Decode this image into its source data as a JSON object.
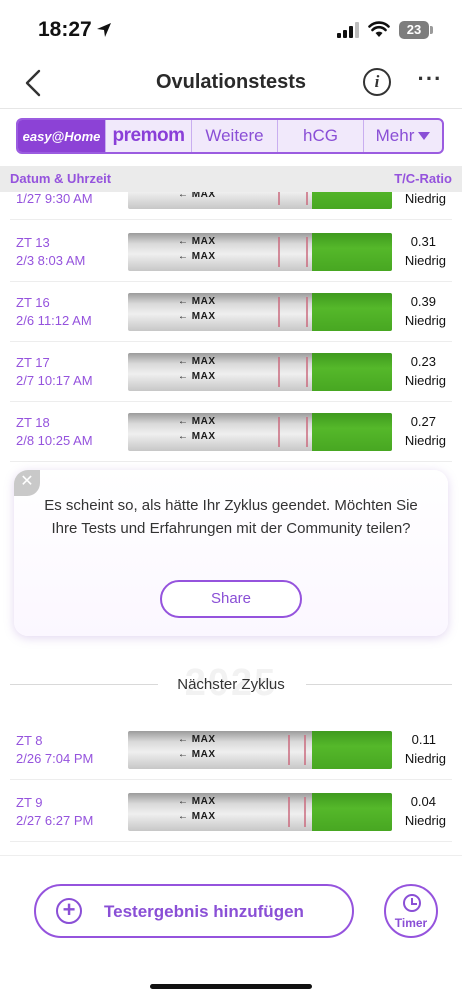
{
  "status": {
    "time": "18:27",
    "battery": "23"
  },
  "header": {
    "title": "Ovulationstests"
  },
  "tabs": [
    {
      "label": "easy@Home",
      "active": true
    },
    {
      "label": "premom"
    },
    {
      "label": "Weitere"
    },
    {
      "label": "hCG"
    },
    {
      "label": "Mehr"
    }
  ],
  "columns": {
    "date": "Datum & Uhrzeit",
    "ratio": "T/C-Ratio"
  },
  "strip_text": "MAX",
  "tests_cycle1": [
    {
      "day": "",
      "datetime": "1/27 9:30 AM",
      "ratio": "",
      "level": "Niedrig"
    },
    {
      "day": "ZT 13",
      "datetime": "2/3 8:03 AM",
      "ratio": "0.31",
      "level": "Niedrig"
    },
    {
      "day": "ZT 16",
      "datetime": "2/6 11:12 AM",
      "ratio": "0.39",
      "level": "Niedrig"
    },
    {
      "day": "ZT 17",
      "datetime": "2/7 10:17 AM",
      "ratio": "0.23",
      "level": "Niedrig"
    },
    {
      "day": "ZT 18",
      "datetime": "2/8 10:25 AM",
      "ratio": "0.27",
      "level": "Niedrig"
    }
  ],
  "popup": {
    "message": "Es scheint so, als hätte Ihr Zyklus geendet. Möchten Sie Ihre Tests und Erfahrungen mit der Community teilen?",
    "share": "Share"
  },
  "next_cycle": {
    "year": "2025",
    "label": "Nächster Zyklus"
  },
  "tests_cycle2": [
    {
      "day": "ZT 8",
      "datetime": "2/26 7:04 PM",
      "ratio": "0.11",
      "level": "Niedrig"
    },
    {
      "day": "ZT 9",
      "datetime": "2/27 6:27 PM",
      "ratio": "0.04",
      "level": "Niedrig"
    }
  ],
  "actions": {
    "add": "Testergebnis hinzufügen",
    "timer": "Timer"
  },
  "colors": {
    "accent": "#9553dd",
    "strip_green": "#55b82a"
  }
}
